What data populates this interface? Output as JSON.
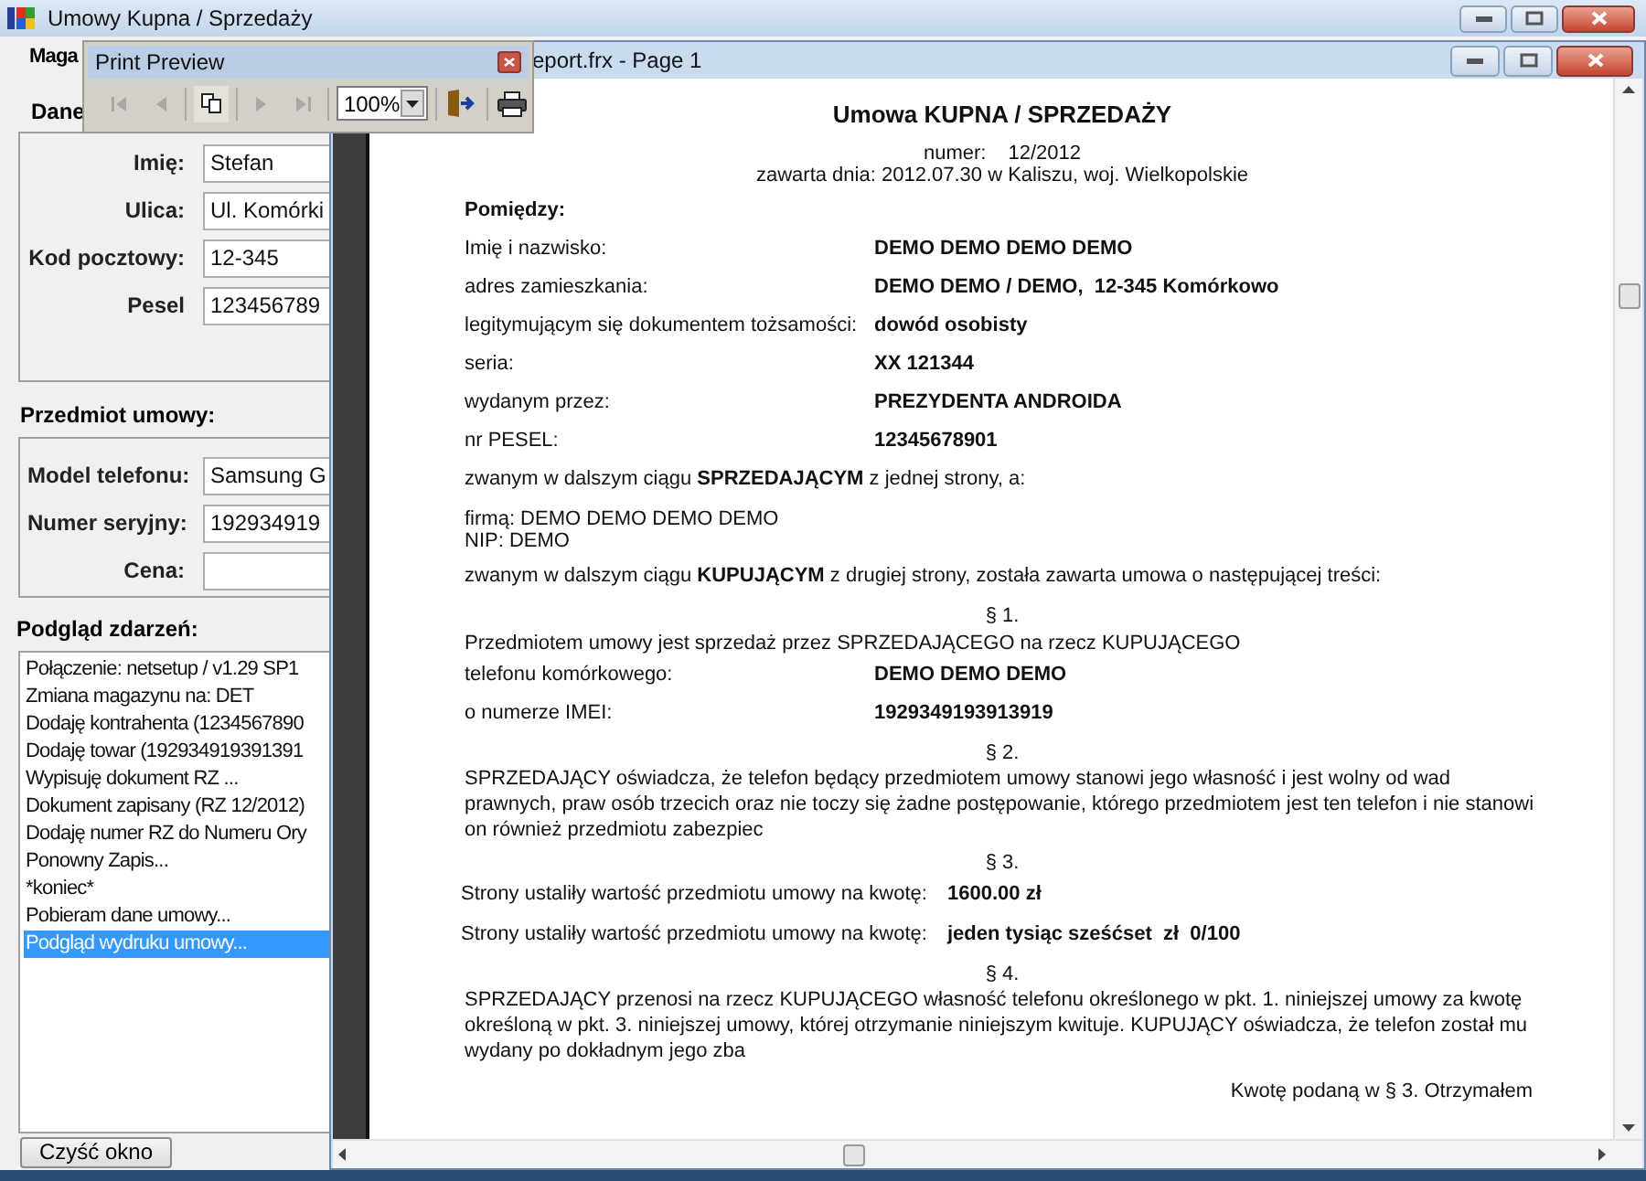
{
  "window": {
    "title": "Umowy Kupna / Sprzedaży"
  },
  "form": {
    "tab_label": "Maga",
    "section_label": "Dane",
    "customer_fields": [
      {
        "label": "Imię:",
        "value": "Stefan"
      },
      {
        "label": "Ulica:",
        "value": "Ul. Komórki"
      },
      {
        "label": "Kod pocztowy:",
        "value": "12-345"
      },
      {
        "label": "Pesel",
        "value": "123456789"
      }
    ],
    "subject_label": "Przedmiot umowy:",
    "subject_fields": [
      {
        "label": "Model telefonu:",
        "value": "Samsung G"
      },
      {
        "label": "Numer seryjny:",
        "value": "192934919"
      },
      {
        "label": "Cena:"
      }
    ],
    "events_label": "Podgląd zdarzeń:",
    "events": [
      {
        "text": "Połączenie: netsetup / v1.29 SP1",
        "selected": false
      },
      {
        "text": "Zmiana magazynu na: DET",
        "selected": false
      },
      {
        "text": "Dodaję kontrahenta (1234567890",
        "selected": false
      },
      {
        "text": "Dodaję towar (192934919391391",
        "selected": false
      },
      {
        "text": "Wypisuję dokument RZ ...",
        "selected": false
      },
      {
        "text": "Dokument zapisany (RZ 12/2012)",
        "selected": false
      },
      {
        "text": "Dodaję numer RZ do Numeru Ory",
        "selected": false
      },
      {
        "text": "Ponowny Zapis...",
        "selected": false
      },
      {
        "text": "*koniec*",
        "selected": false
      },
      {
        "text": "Pobieram dane umowy...",
        "selected": false
      },
      {
        "text": "Podgląd wydruku umowy...",
        "selected": true
      }
    ],
    "clear_button": "Czyść okno"
  },
  "report_window": {
    "title": "eport.frx - Page 1",
    "document": [
      {
        "kind": "title",
        "text": "Umowa KUPNA / SPRZEDAŻY"
      },
      {
        "kind": "center_pair",
        "label": "numer:",
        "value": "12/2012"
      },
      {
        "kind": "center",
        "text": "zawarta dnia: 2012.07.30 w Kaliszu, woj. Wielkopolskie"
      },
      {
        "kind": "heading",
        "text": "Pomiędzy:"
      },
      {
        "kind": "pair",
        "label": "Imię i nazwisko:",
        "value": "DEMO DEMO DEMO DEMO"
      },
      {
        "kind": "pair",
        "label": "adres zamieszkania:",
        "value": "DEMO DEMO / DEMO,  12-345 Komórkowo"
      },
      {
        "kind": "pair",
        "label": "legitymującym się dokumentem tożsamości:",
        "value": "dowód osobisty"
      },
      {
        "kind": "pair",
        "label": "seria:",
        "value": "XX 121344"
      },
      {
        "kind": "pair",
        "label": "wydanym przez:",
        "value": "PREZYDENTA ANDROIDA"
      },
      {
        "kind": "pair",
        "label": "nr PESEL:",
        "value": "12345678901"
      },
      {
        "kind": "text",
        "text": "zwanym w dalszym ciągu **SPRZEDAJĄCYM** z jednej strony, a:"
      },
      {
        "kind": "lines",
        "lines": [
          "firmą: DEMO DEMO DEMO DEMO",
          "NIP: DEMO"
        ]
      },
      {
        "kind": "text",
        "text": "zwanym w dalszym ciągu **KUPUJĄCYM** z drugiej strony, została zawarta umowa o następującej treści:"
      },
      {
        "kind": "section",
        "text": "§ 1."
      },
      {
        "kind": "plain",
        "text": "Przedmiotem umowy jest sprzedaż przez SPRZEDAJĄCEGO na rzecz KUPUJĄCEGO"
      },
      {
        "kind": "pair",
        "label": "telefonu komórkowego:",
        "value": "DEMO DEMO DEMO"
      },
      {
        "kind": "pair",
        "label": "o numerze IMEI:",
        "value": "1929349193913919"
      },
      {
        "kind": "section",
        "text": "§ 2."
      },
      {
        "kind": "paragraph",
        "text": "SPRZEDAJĄCY oświadcza, że telefon będący przedmiotem umowy stanowi jego własność i jest wolny od wad prawnych, praw osób trzecich oraz nie toczy się żadne postępowanie, którego przedmiotem jest ten telefon i nie stanowi on również przedmiotu zabezpiec"
      },
      {
        "kind": "section",
        "text": "§ 3."
      },
      {
        "kind": "amount",
        "label": "Strony ustaliły wartość przedmiotu umowy na kwotę:",
        "value": "1600.00 zł"
      },
      {
        "kind": "amount",
        "label": "Strony ustaliły wartość przedmiotu umowy na kwotę:",
        "value": "jeden tysiąc sześćset  zł  0/100"
      },
      {
        "kind": "section",
        "text": "§ 4."
      },
      {
        "kind": "paragraph",
        "text": "SPRZEDAJĄCY przenosi na rzecz KUPUJĄCEGO własność telefonu określonego w pkt. 1. niniejszej umowy za kwotę określoną w pkt. 3. niniejszej umowy, której otrzymanie niniejszym kwituje. KUPUJĄCY oświadcza, że telefon został mu wydany po dokładnym jego zba"
      },
      {
        "kind": "right",
        "text": "Kwotę podaną w § 3. Otrzymałem"
      }
    ]
  },
  "print_preview": {
    "title": "Print Preview",
    "zoom": "100%",
    "nav_buttons": [
      {
        "kind": "first",
        "disabled": true
      },
      {
        "kind": "prev",
        "disabled": true
      },
      {
        "kind": "copy",
        "disabled": false
      },
      {
        "kind": "next",
        "disabled": true
      },
      {
        "kind": "last",
        "disabled": true
      }
    ]
  }
}
